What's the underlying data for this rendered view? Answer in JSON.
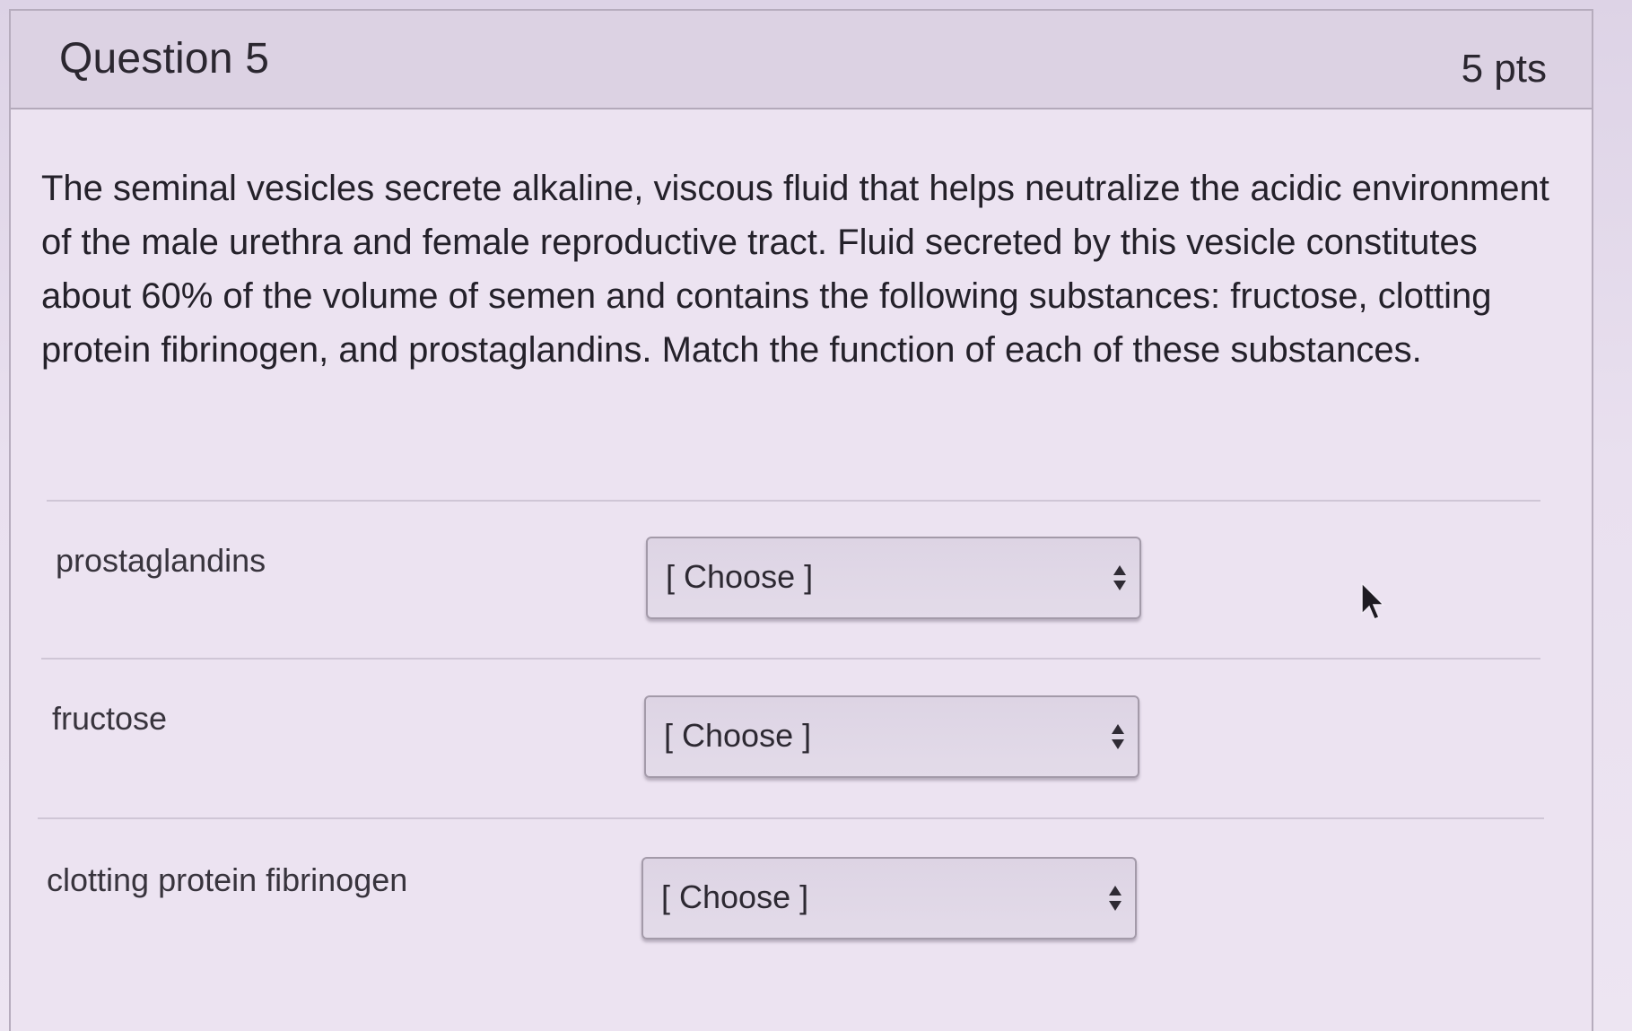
{
  "question": {
    "title": "Question 5",
    "points": "5 pts",
    "text": "The seminal vesicles secrete alkaline, viscous fluid that helps neutralize the acidic environment of the male urethra and female reproductive tract. Fluid secreted by this vesicle constitutes about 60% of the volume of semen and contains the following substances: fructose, clotting protein fibrinogen, and prostaglandins. Match the function of each of these substances."
  },
  "matches": [
    {
      "label": "prostaglandins",
      "selected": "[ Choose ]"
    },
    {
      "label": "fructose",
      "selected": "[ Choose ]"
    },
    {
      "label": "clotting protein fibrinogen",
      "selected": "[ Choose ]"
    }
  ],
  "icons": {
    "select_arrows": "up-down-arrows-icon",
    "cursor": "mouse-pointer-icon"
  }
}
